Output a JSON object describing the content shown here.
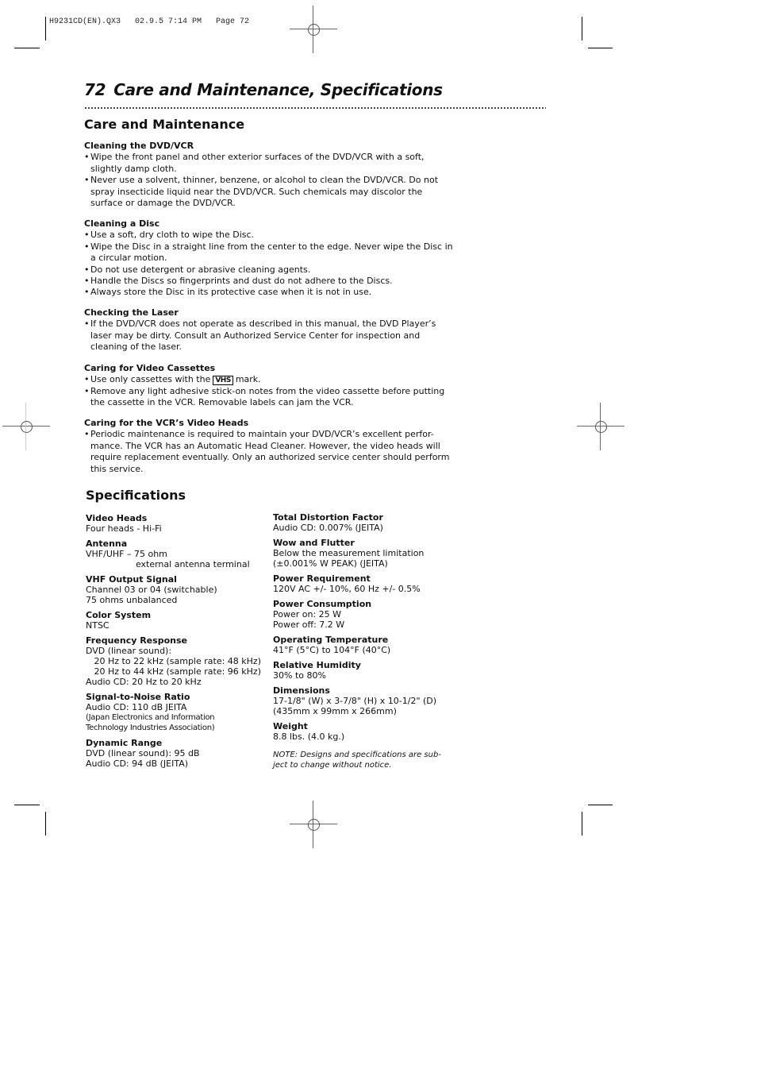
{
  "slug": "H9231CD(EN).QX3   02.9.5 7:14 PM   Page 72",
  "header": {
    "page_number": "72",
    "title": "Care and Maintenance, Specifications"
  },
  "care": {
    "heading": "Care and Maintenance",
    "sections": [
      {
        "title": "Cleaning the DVD/VCR",
        "items": [
          "Wipe the front panel and other exterior surfaces of the DVD/VCR with a soft, slightly damp cloth.",
          "Never use a solvent, thinner, benzene, or alcohol to clean the DVD/VCR. Do not spray insecticide liquid near the DVD/VCR. Such chemicals may discolor the surface or damage the DVD/VCR."
        ]
      },
      {
        "title": "Cleaning a Disc",
        "items": [
          "Use a soft, dry cloth to wipe the Disc.",
          "Wipe the Disc in a straight line from the center to the edge. Never wipe the Disc in a circular motion.",
          "Do not use detergent or abrasive cleaning agents.",
          "Handle the Discs so fingerprints and dust do not adhere to the Discs.",
          "Always store the Disc in its protective case when it is not in use."
        ]
      },
      {
        "title": "Checking the Laser",
        "items": [
          "If the DVD/VCR does not operate as described in this manual, the DVD Player’s laser may be dirty. Consult an Authorized Service Center for inspection and cleaning of the laser."
        ]
      },
      {
        "title": "Caring for Video Cassettes",
        "vhs_item": {
          "before": "Use only cassettes with the",
          "logo": "VHS",
          "after": "mark."
        },
        "items": [
          "Remove any light adhesive stick-on notes from the video cassette before putting the cassette in the VCR. Removable labels can jam the VCR."
        ]
      },
      {
        "title": "Caring for the VCR’s Video Heads",
        "items": [
          "Periodic maintenance is required to maintain your DVD/VCR’s excellent perfor- mance. The VCR has an Automatic Head Cleaner. However, the video heads will require replacement eventually. Only an authorized service center should perform this service."
        ]
      }
    ]
  },
  "specs": {
    "heading": "Specifications",
    "left": [
      {
        "title": "Video Heads",
        "lines": [
          "Four heads - Hi-Fi"
        ]
      },
      {
        "title": "Antenna",
        "lines": [
          "VHF/UHF – 75 ohm",
          "                  external antenna terminal"
        ]
      },
      {
        "title": "VHF Output Signal",
        "lines": [
          "Channel 03 or 04 (switchable)",
          "75 ohms unbalanced"
        ]
      },
      {
        "title": "Color System",
        "lines": [
          "NTSC"
        ]
      },
      {
        "title": "Frequency Response",
        "lines": [
          "DVD (linear sound):",
          "   20 Hz to 22 kHz (sample rate: 48 kHz)",
          "   20 Hz to 44 kHz (sample rate: 96 kHz)",
          "Audio CD: 20 Hz to 20 kHz"
        ]
      },
      {
        "title": "Signal-to-Noise Ratio",
        "lines": [
          "Audio CD: 110 dB JEITA"
        ],
        "small": [
          "(Japan Electronics and Information",
          "Technology Industries Association)"
        ]
      },
      {
        "title": "Dynamic Range",
        "lines": [
          "DVD (linear sound): 95 dB",
          "Audio CD: 94 dB (JEITA)"
        ]
      }
    ],
    "right": [
      {
        "title": "Total Distortion Factor",
        "lines": [
          "Audio CD: 0.007% (JEITA)"
        ]
      },
      {
        "title": "Wow and Flutter",
        "lines": [
          "Below the measurement limitation",
          "(±0.001% W PEAK) (JEITA)"
        ]
      },
      {
        "title": "Power Requirement",
        "lines": [
          "120V AC +/- 10%, 60 Hz +/- 0.5%"
        ]
      },
      {
        "title": "Power Consumption",
        "lines": [
          "Power on: 25 W",
          "Power off: 7.2 W"
        ]
      },
      {
        "title": "Operating Temperature",
        "lines": [
          "41°F (5°C) to 104°F (40°C)"
        ]
      },
      {
        "title": "Relative Humidity",
        "lines": [
          "30% to 80%"
        ]
      },
      {
        "title": "Dimensions",
        "lines": [
          "17-1/8\" (W) x 3-7/8\" (H) x 10-1/2\" (D)",
          "(435mm x 99mm x 266mm)"
        ]
      },
      {
        "title": "Weight",
        "lines": [
          "8.8 lbs. (4.0 kg.)"
        ]
      }
    ],
    "note": "NOTE: Designs and specifications are sub-\nject to change without notice."
  }
}
